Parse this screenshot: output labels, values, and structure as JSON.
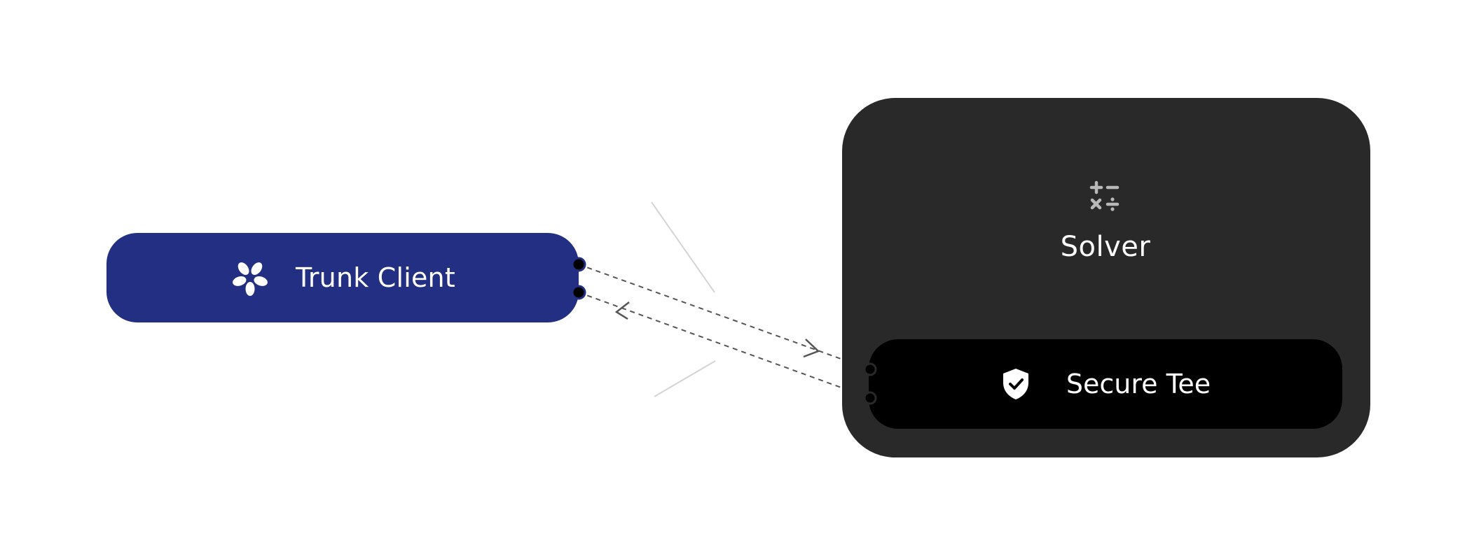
{
  "nodes": {
    "client": {
      "label": "Trunk Client",
      "icon": "flower-asterisk-icon",
      "color": "#232f82"
    },
    "solver": {
      "label": "Solver",
      "icon": "calculator-operators-icon",
      "color": "#292929"
    },
    "tee": {
      "label": "Secure Tee",
      "icon": "shield-check-icon",
      "color": "#000000"
    }
  },
  "edges": [
    {
      "from": "client",
      "to": "tee",
      "style": "dashed",
      "arrow": "forward"
    },
    {
      "from": "tee",
      "to": "client",
      "style": "dashed",
      "arrow": "backward"
    }
  ]
}
